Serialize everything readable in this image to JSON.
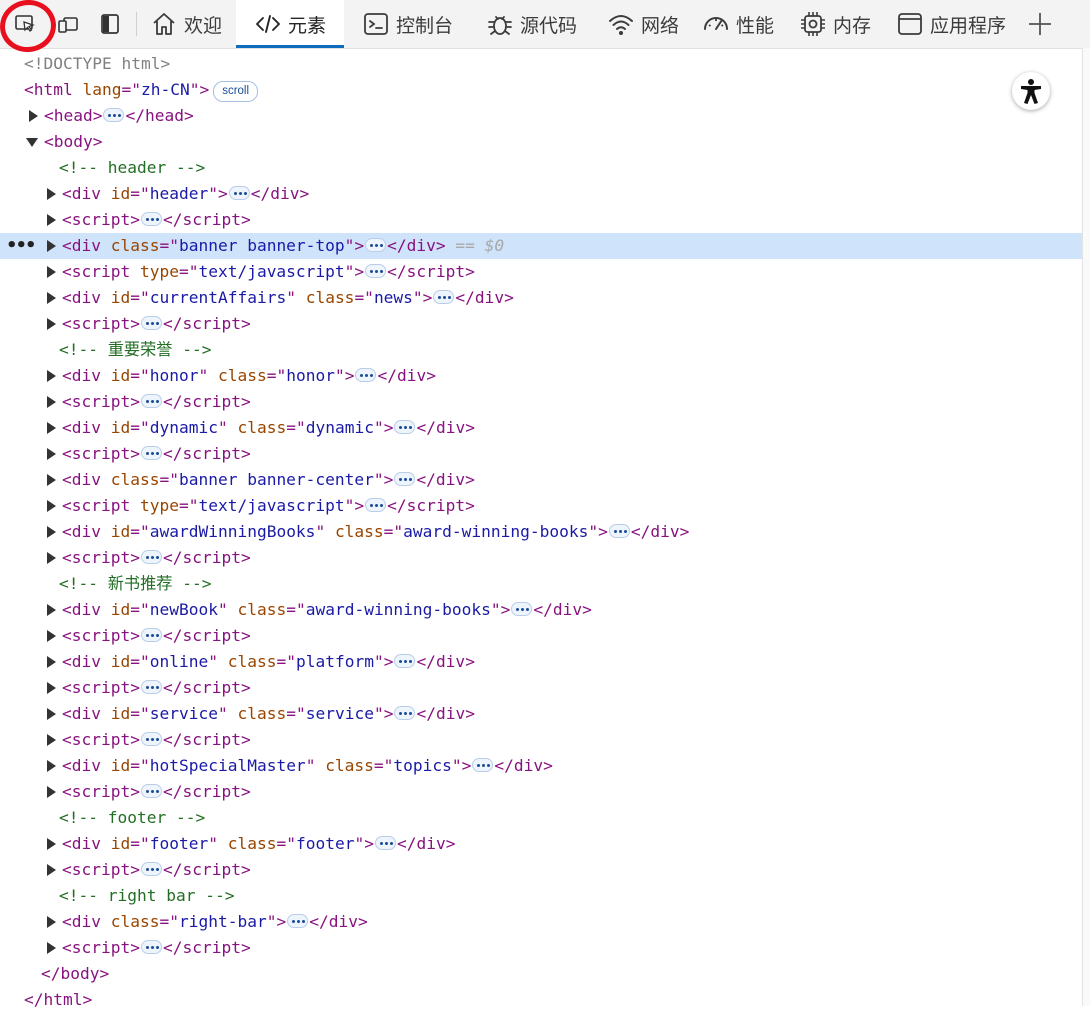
{
  "toolbar": {
    "tabs": [
      {
        "label": "欢迎",
        "icon": "home-icon"
      },
      {
        "label": "元素",
        "icon": "code-icon",
        "active": true
      },
      {
        "label": "控制台",
        "icon": "console-icon"
      },
      {
        "label": "源代码",
        "icon": "bug-icon"
      },
      {
        "label": "网络",
        "icon": "wifi-icon"
      },
      {
        "label": "性能",
        "icon": "gauge-icon"
      },
      {
        "label": "内存",
        "icon": "chip-icon"
      },
      {
        "label": "应用程序",
        "icon": "app-window-icon"
      }
    ],
    "left_icons": [
      "inspect-icon",
      "device-emulation-icon",
      "dock-sidebar-icon"
    ],
    "plus_icon": "plus-icon",
    "highlight_color": "#e8101e",
    "accent_color": "#0f6cbd"
  },
  "tree": {
    "doctype": "<!DOCTYPE html>",
    "scroll_badge": "scroll",
    "selected_suffix": "== $0",
    "selected_color": "#cfe3fb",
    "lines": [
      {
        "type": "doctype"
      },
      {
        "type": "open",
        "tag": "html",
        "attrs": [
          [
            "lang",
            "zh-CN"
          ]
        ],
        "badge": true
      },
      {
        "type": "collapsed",
        "tag": "head",
        "attrs": []
      },
      {
        "type": "open",
        "tag": "body",
        "attrs": []
      },
      {
        "type": "comment",
        "text": "header"
      },
      {
        "type": "collapsed",
        "tag": "div",
        "attrs": [
          [
            "id",
            "header"
          ]
        ]
      },
      {
        "type": "collapsed",
        "tag": "script",
        "attrs": []
      },
      {
        "type": "collapsed",
        "tag": "div",
        "attrs": [
          [
            "class",
            "banner banner-top"
          ]
        ],
        "selected": true
      },
      {
        "type": "collapsed",
        "tag": "script",
        "attrs": [
          [
            "type",
            "text/javascript"
          ]
        ]
      },
      {
        "type": "collapsed",
        "tag": "div",
        "attrs": [
          [
            "id",
            "currentAffairs"
          ],
          [
            "class",
            "news"
          ]
        ]
      },
      {
        "type": "collapsed",
        "tag": "script",
        "attrs": []
      },
      {
        "type": "comment",
        "text": "重要荣誉"
      },
      {
        "type": "collapsed",
        "tag": "div",
        "attrs": [
          [
            "id",
            "honor"
          ],
          [
            "class",
            "honor"
          ]
        ]
      },
      {
        "type": "collapsed",
        "tag": "script",
        "attrs": []
      },
      {
        "type": "collapsed",
        "tag": "div",
        "attrs": [
          [
            "id",
            "dynamic"
          ],
          [
            "class",
            "dynamic"
          ]
        ]
      },
      {
        "type": "collapsed",
        "tag": "script",
        "attrs": []
      },
      {
        "type": "collapsed",
        "tag": "div",
        "attrs": [
          [
            "class",
            "banner banner-center"
          ]
        ]
      },
      {
        "type": "collapsed",
        "tag": "script",
        "attrs": [
          [
            "type",
            "text/javascript"
          ]
        ]
      },
      {
        "type": "collapsed",
        "tag": "div",
        "attrs": [
          [
            "id",
            "awardWinningBooks"
          ],
          [
            "class",
            "award-winning-books"
          ]
        ]
      },
      {
        "type": "collapsed",
        "tag": "script",
        "attrs": []
      },
      {
        "type": "comment",
        "text": "新书推荐"
      },
      {
        "type": "collapsed",
        "tag": "div",
        "attrs": [
          [
            "id",
            "newBook"
          ],
          [
            "class",
            "award-winning-books"
          ]
        ]
      },
      {
        "type": "collapsed",
        "tag": "script",
        "attrs": []
      },
      {
        "type": "collapsed",
        "tag": "div",
        "attrs": [
          [
            "id",
            "online"
          ],
          [
            "class",
            "platform"
          ]
        ]
      },
      {
        "type": "collapsed",
        "tag": "script",
        "attrs": []
      },
      {
        "type": "collapsed",
        "tag": "div",
        "attrs": [
          [
            "id",
            "service"
          ],
          [
            "class",
            "service"
          ]
        ]
      },
      {
        "type": "collapsed",
        "tag": "script",
        "attrs": []
      },
      {
        "type": "collapsed",
        "tag": "div",
        "attrs": [
          [
            "id",
            "hotSpecialMaster"
          ],
          [
            "class",
            "topics"
          ]
        ]
      },
      {
        "type": "collapsed",
        "tag": "script",
        "attrs": []
      },
      {
        "type": "comment",
        "text": "footer"
      },
      {
        "type": "collapsed",
        "tag": "div",
        "attrs": [
          [
            "id",
            "footer"
          ],
          [
            "class",
            "footer"
          ]
        ]
      },
      {
        "type": "collapsed",
        "tag": "script",
        "attrs": []
      },
      {
        "type": "comment",
        "text": "right bar"
      },
      {
        "type": "collapsed",
        "tag": "div",
        "attrs": [
          [
            "class",
            "right-bar"
          ]
        ]
      },
      {
        "type": "collapsed",
        "tag": "script",
        "attrs": []
      },
      {
        "type": "close",
        "tag": "body"
      },
      {
        "type": "close",
        "tag": "html"
      }
    ]
  },
  "accessibility_button": {
    "icon": "accessibility-icon"
  }
}
